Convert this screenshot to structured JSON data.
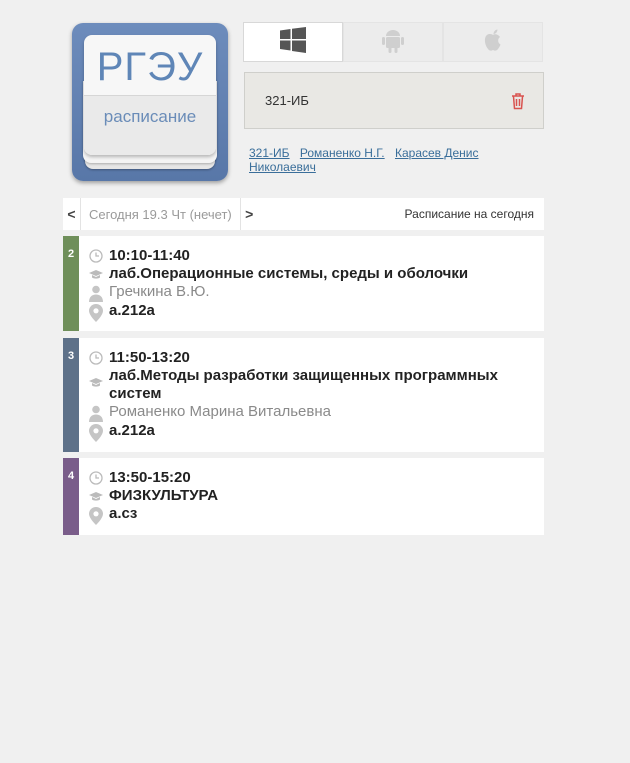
{
  "logo": {
    "title": "РГЭУ",
    "subtitle": "расписание"
  },
  "os_tabs": [
    {
      "name": "windows",
      "icon": "windows-icon",
      "active": true
    },
    {
      "name": "android",
      "icon": "android-icon",
      "active": false
    },
    {
      "name": "apple",
      "icon": "apple-icon",
      "active": false
    }
  ],
  "group_box": {
    "name": "321-ИБ",
    "icon": "trash-icon"
  },
  "links": [
    "321-ИБ",
    "Романенко Н.Г.",
    "Карасев Денис Николаевич"
  ],
  "date_nav": {
    "prev": "<",
    "date": "Сегодня 19.3 Чт (нечет)",
    "next": ">",
    "today": "Расписание на сегодня"
  },
  "lessons": [
    {
      "num": "2",
      "color": "#6f8f5a",
      "time": "10:10-11:40",
      "subject": "лаб.Операционные системы, среды и оболочки",
      "teacher": "Гречкина В.Ю.",
      "room": "а.212а"
    },
    {
      "num": "3",
      "color": "#5e7189",
      "time": "11:50-13:20",
      "subject": "лаб.Методы разработки защищенных программных систем",
      "teacher": "Романенко Марина Витальевна",
      "room": "а.212а"
    },
    {
      "num": "4",
      "color": "#7a5d8a",
      "time": "13:50-15:20",
      "subject": "ФИЗКУЛЬТУРА",
      "teacher": "",
      "room": "а.сз"
    }
  ]
}
